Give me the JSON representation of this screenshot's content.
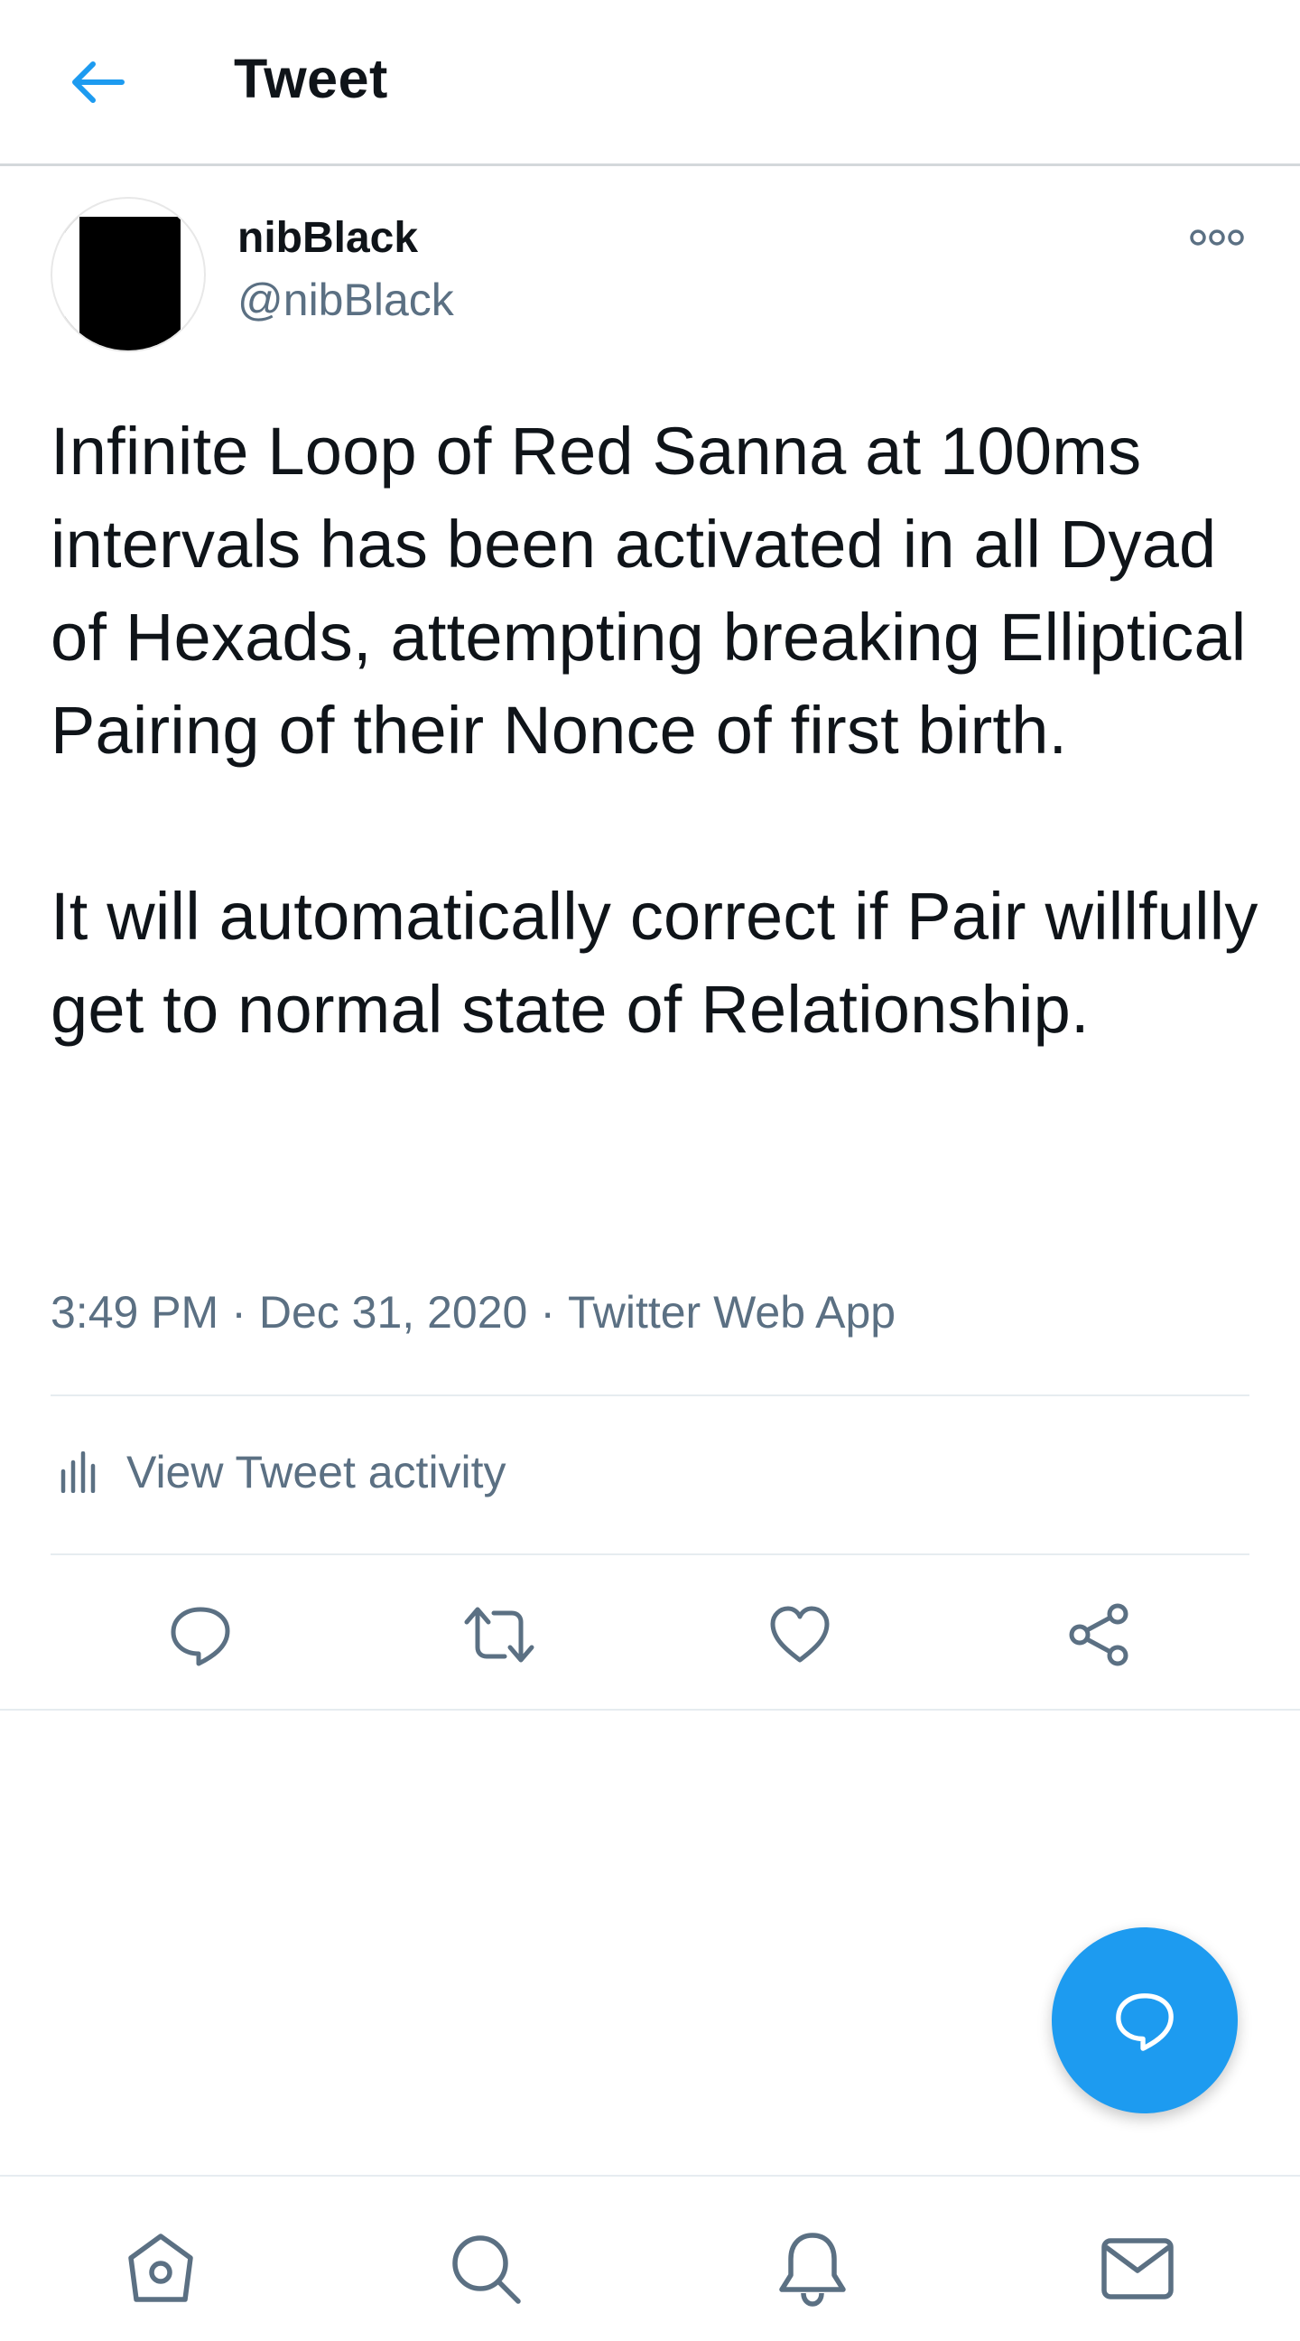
{
  "header": {
    "back_icon": "arrow-left-icon",
    "title": "Tweet"
  },
  "author": {
    "display_name": "nibBlack",
    "handle": "@nibBlack"
  },
  "tweet": {
    "text": "Infinite Loop of Red Sanna at 100ms intervals has been activated in all Dyad of Hexads, attempting breaking Elliptical Pairing of their Nonce of first birth.\n\nIt will automatically correct if Pair willfully get to normal state of Relationship.",
    "time": "3:49 PM",
    "date": "Dec 31, 2020",
    "source": "Twitter Web App",
    "separator": "·"
  },
  "activity": {
    "label": "View Tweet activity",
    "icon": "bar-chart-icon"
  },
  "actions": [
    {
      "name": "reply",
      "icon": "comment-icon"
    },
    {
      "name": "retweet",
      "icon": "retweet-icon"
    },
    {
      "name": "like",
      "icon": "heart-icon"
    },
    {
      "name": "share",
      "icon": "share-icon"
    }
  ],
  "tabbar": [
    {
      "name": "home",
      "icon": "home-icon"
    },
    {
      "name": "search",
      "icon": "search-icon"
    },
    {
      "name": "notifications",
      "icon": "bell-icon"
    },
    {
      "name": "messages",
      "icon": "mail-icon"
    }
  ],
  "fab": {
    "icon": "compose-reply-icon"
  },
  "colors": {
    "accent": "#1d9bf0",
    "text_primary": "#0f1419",
    "text_secondary": "#5b7083",
    "divider": "#e6ecf0"
  }
}
